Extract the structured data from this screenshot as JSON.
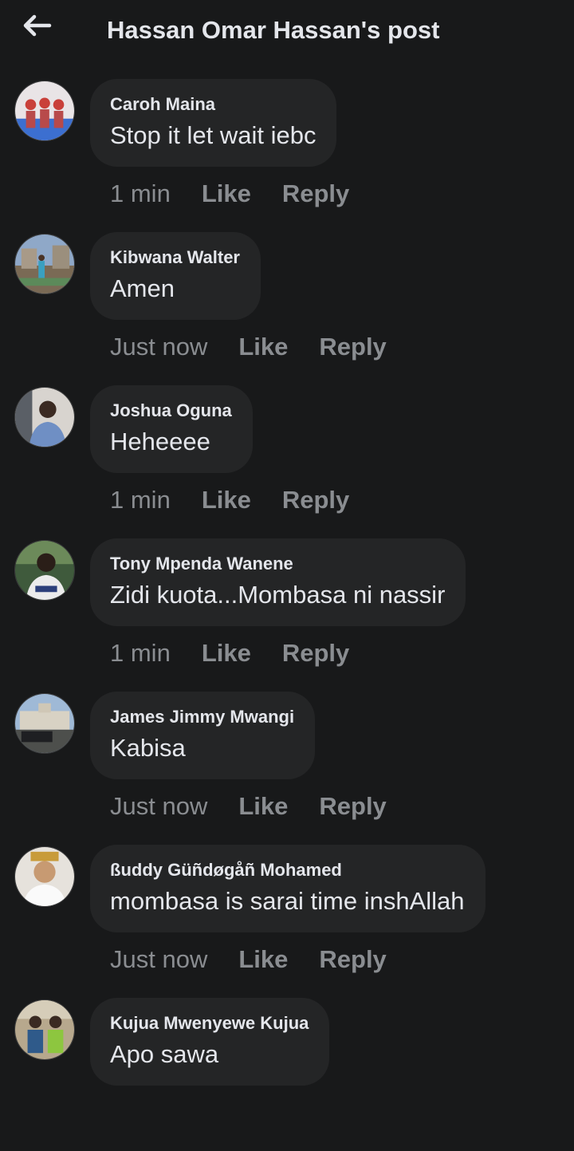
{
  "header": {
    "title": "Hassan Omar Hassan's post",
    "back_icon": "arrow-left-icon"
  },
  "colors": {
    "background": "#18191a",
    "bubble": "#242526",
    "text_primary": "#e4e6eb",
    "text_secondary": "#8a8d91"
  },
  "actions": {
    "like": "Like",
    "reply": "Reply"
  },
  "comments": [
    {
      "author": "Caroh Maina",
      "text": "Stop it let wait iebc",
      "time": "1 min"
    },
    {
      "author": "Kibwana Walter",
      "text": "Amen",
      "time": "Just now"
    },
    {
      "author": "Joshua Oguna",
      "text": "Heheeee",
      "time": "1 min"
    },
    {
      "author": "Tony Mpenda Wanene",
      "text": "Zidi kuota...Mombasa ni nassir",
      "time": "1 min"
    },
    {
      "author": "James Jimmy Mwangi",
      "text": "Kabisa",
      "time": "Just now"
    },
    {
      "author": "ßuddy Güñdøgåñ Mohamed",
      "text": "mombasa is sarai time inshAllah",
      "time": "Just now"
    },
    {
      "author": "Kujua Mwenyewe Kujua",
      "text": "Apo sawa",
      "time": ""
    }
  ]
}
